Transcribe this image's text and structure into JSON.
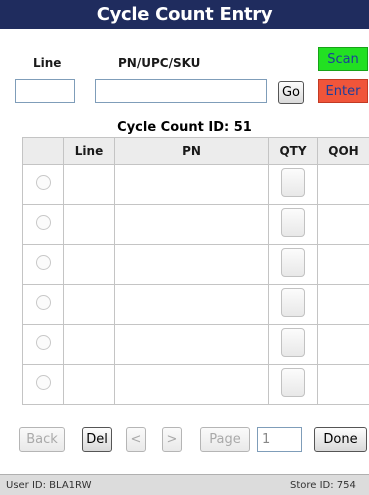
{
  "header": {
    "title": "Cycle Count Entry"
  },
  "form": {
    "line_label": "Line",
    "pn_label": "PN/UPC/SKU",
    "line_value": "",
    "pn_value": "",
    "go_label": "Go",
    "scan_label": "Scan",
    "enter_label": "Enter"
  },
  "cycle_count": {
    "label": "Cycle Count ID: 51"
  },
  "table": {
    "columns": [
      "",
      "Line",
      "PN",
      "QTY",
      "QOH"
    ],
    "rows": [
      {
        "line": "",
        "pn": "",
        "qoh": ""
      },
      {
        "line": "",
        "pn": "",
        "qoh": ""
      },
      {
        "line": "",
        "pn": "",
        "qoh": ""
      },
      {
        "line": "",
        "pn": "",
        "qoh": ""
      },
      {
        "line": "",
        "pn": "",
        "qoh": ""
      },
      {
        "line": "",
        "pn": "",
        "qoh": ""
      }
    ]
  },
  "pager": {
    "back_label": "Back",
    "del_label": "Del",
    "prev_label": "<",
    "next_label": ">",
    "page_label": "Page",
    "page_value": "1",
    "done_label": "Done"
  },
  "status": {
    "user": "User ID: BLA1RW",
    "store": "Store ID: 754"
  },
  "colors": {
    "title_bar": "#1f2c5e",
    "scan_button": "#22e022",
    "enter_button": "#f0553a"
  }
}
